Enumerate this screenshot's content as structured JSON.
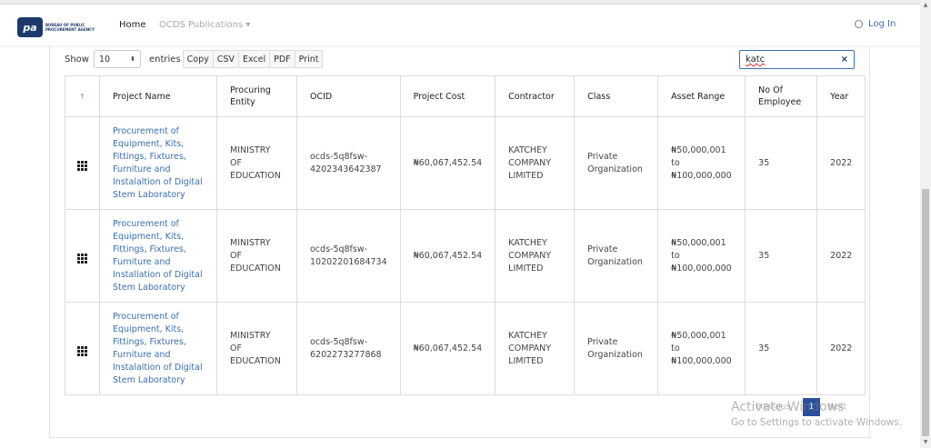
{
  "brand": {
    "logo_text": "pa",
    "agency_name": "BUREAU OF PUBLIC PROCUREMENT AGENCY"
  },
  "nav": {
    "home": "Home",
    "publications": "OCDS Publications",
    "login": "Log In"
  },
  "controls": {
    "show_label": "Show",
    "page_size": "10",
    "entries_label": "entries"
  },
  "export_buttons": [
    "Copy",
    "CSV",
    "Excel",
    "PDF",
    "Print"
  ],
  "search": {
    "value": "katc",
    "clear": "×"
  },
  "table": {
    "headers": [
      "Project Name",
      "Procuring Entity",
      "OCID",
      "Project Cost",
      "Contractor",
      "Class",
      "Asset Range",
      "No Of Employee",
      "Year"
    ],
    "sort_indicator": "↑",
    "rows": [
      {
        "project_name": "Procurement of Equipment, Kits, Fittings, Fixtures, Furniture and Instalaltion of Digital Stem Laboratory",
        "procuring_entity": "MINISTRY OF EDUCATION",
        "ocid": "ocds-5q8fsw-4202343642387",
        "project_cost": "₦60,067,452.54",
        "contractor": "KATCHEY COMPANY LIMITED",
        "class": "Private Organization",
        "asset_range": "₦50,000,001 to ₦100,000,000",
        "employees": "35",
        "year": "2022"
      },
      {
        "project_name": "Procurement of Equipment, Kits, Fittings, Fixtures, Furniture and Installation of Digital Stem Laboratory",
        "procuring_entity": "MINISTRY OF EDUCATION",
        "ocid": "ocds-5q8fsw-10202201684734",
        "project_cost": "₦60,067,452.54",
        "contractor": "KATCHEY COMPANY LIMITED",
        "class": "Private Organization",
        "asset_range": "₦50,000,001 to ₦100,000,000",
        "employees": "35",
        "year": "2022"
      },
      {
        "project_name": "Procurement of Equipment, Kits, Fittings, Fixtures, Furniture and Instalaltion of Digital Stem Laboratory",
        "procuring_entity": "MINISTRY OF EDUCATION",
        "ocid": "ocds-5q8fsw-6202273277868",
        "project_cost": "₦60,067,452.54",
        "contractor": "KATCHEY COMPANY LIMITED",
        "class": "Private Organization",
        "asset_range": "₦50,000,001 to ₦100,000,000",
        "employees": "35",
        "year": "2022"
      }
    ]
  },
  "pagination": {
    "previous": "Previous",
    "current": "1",
    "next": "Next"
  },
  "watermark": {
    "line1": "Activate Windows",
    "line2": "Go to Settings to activate Windows."
  }
}
